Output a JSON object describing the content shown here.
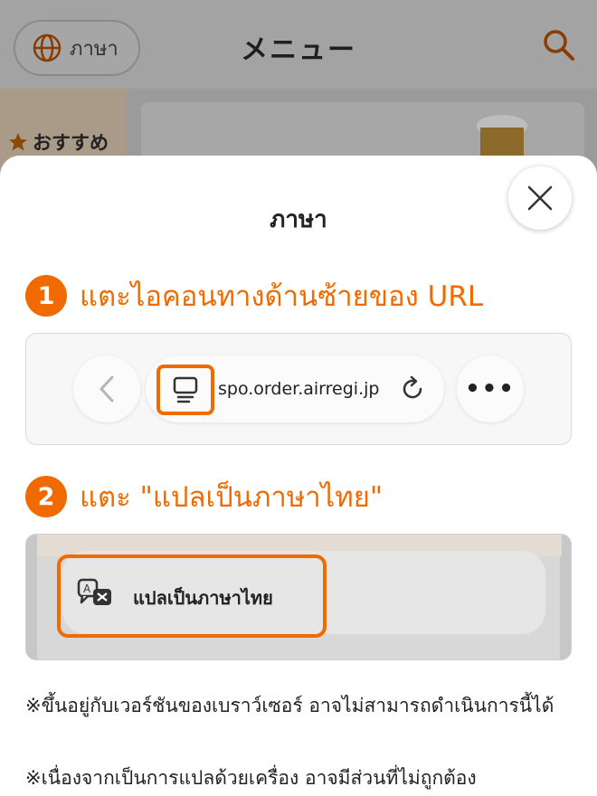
{
  "background": {
    "language_button_label": "ภาษา",
    "title": "メニュー",
    "category": "おすすめ"
  },
  "modal": {
    "title": "ภาษา",
    "step1": {
      "number": "1",
      "text": "แตะไอคอนทางด้านซ้ายของ URL"
    },
    "browser": {
      "url": "spo.order.airregi.jp",
      "more_label": "•••"
    },
    "step2": {
      "number": "2",
      "text": "แตะ \"แปลเป็นภาษาไทย\""
    },
    "translate_option_label": "แปลเป็นภาษาไทย",
    "notes": [
      "※ขึ้นอยู่กับเวอร์ชันของเบราว์เซอร์ อาจไม่สามารถดำเนินการนี้ได้",
      "※เนื่องจากเป็นการแปลด้วยเครื่อง อาจมีส่วนที่ไม่ถูกต้อง"
    ]
  },
  "colors": {
    "accent": "#f06a00"
  },
  "icons": [
    "globe-icon",
    "search-icon",
    "star-icon",
    "beer-image",
    "close-icon",
    "chevron-left-icon",
    "page-reader-icon",
    "reload-icon",
    "more-icon",
    "translate-icon"
  ]
}
